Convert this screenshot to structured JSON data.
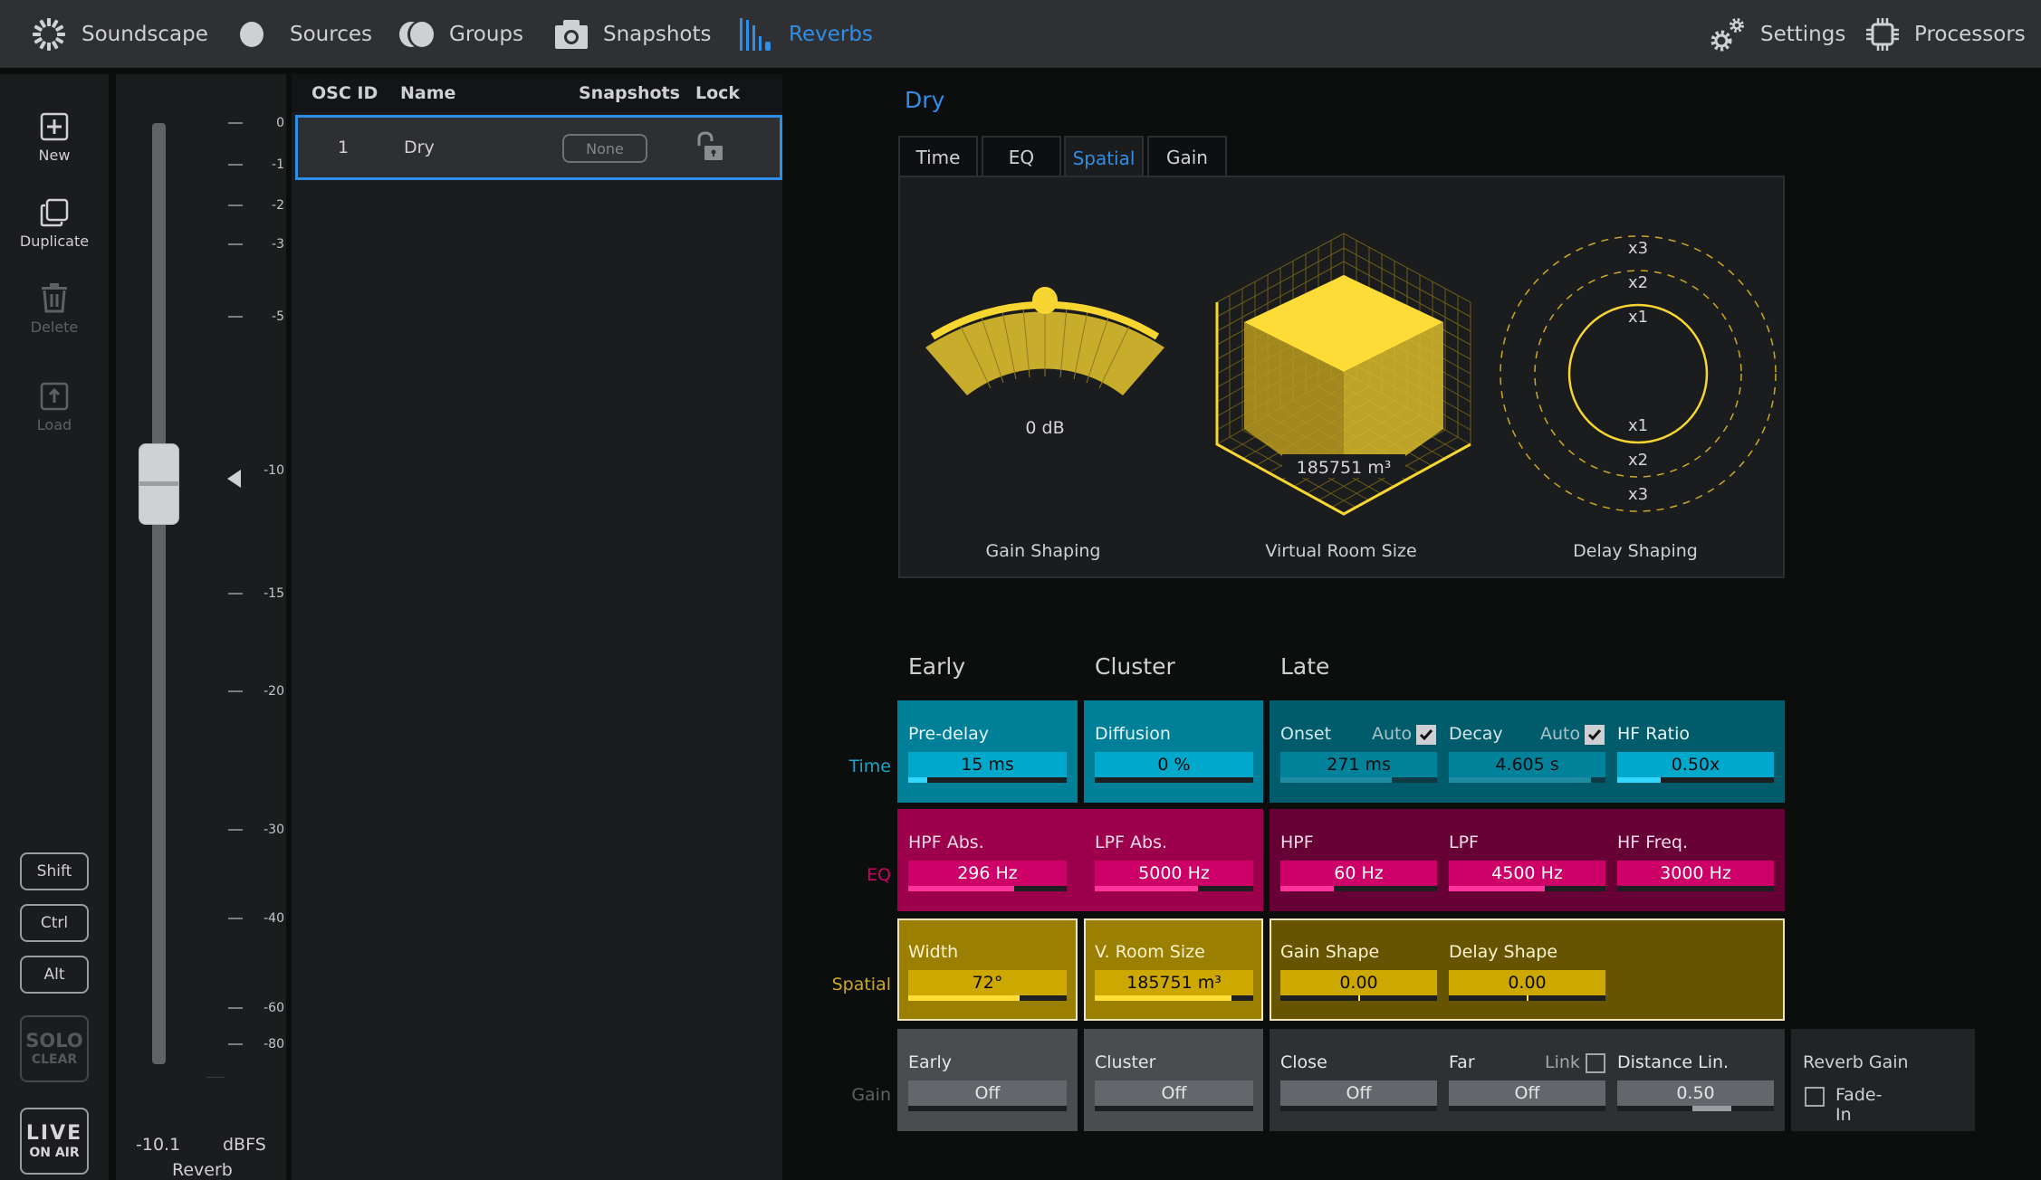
{
  "nav": {
    "items": [
      {
        "label": "Soundscape",
        "icon": "soundscape-icon"
      },
      {
        "label": "Sources",
        "icon": "sources-icon"
      },
      {
        "label": "Groups",
        "icon": "groups-icon"
      },
      {
        "label": "Snapshots",
        "icon": "camera-icon"
      },
      {
        "label": "Reverbs",
        "icon": "reverbs-icon",
        "active": true
      }
    ],
    "right": [
      {
        "label": "Settings",
        "icon": "gears-icon"
      },
      {
        "label": "Processors",
        "icon": "chip-icon"
      }
    ]
  },
  "sidebar": {
    "new": "New",
    "duplicate": "Duplicate",
    "delete": "Delete",
    "load": "Load",
    "shift": "Shift",
    "ctrl": "Ctrl",
    "alt": "Alt",
    "solo_top": "SOLO",
    "solo_bottom": "CLEAR",
    "live_top": "LIVE",
    "live_bottom": "ON AIR"
  },
  "fader": {
    "ticks": [
      "0",
      "-1",
      "-2",
      "-3",
      "-5",
      "-10",
      "-15",
      "-20",
      "-30",
      "-40",
      "-60",
      "-80"
    ],
    "value": "-10.1",
    "unit": "dBFS",
    "name": "Reverb",
    "marker_tick": "-10"
  },
  "list": {
    "headers": {
      "osc_id": "OSC ID",
      "name": "Name",
      "snapshots": "Snapshots",
      "lock": "Lock"
    },
    "rows": [
      {
        "osc_id": "1",
        "name": "Dry",
        "snapshots": "None",
        "locked": false
      }
    ]
  },
  "detail": {
    "title": "Dry",
    "tabs": [
      "Time",
      "EQ",
      "Spatial",
      "Gain"
    ],
    "active_tab": "Spatial",
    "vis": {
      "gain_shaping": {
        "label": "Gain Shaping",
        "value": "0 dB"
      },
      "room_size": {
        "label": "Virtual Room Size",
        "value": "185751 m³"
      },
      "delay_shaping": {
        "label": "Delay Shaping",
        "rings_top": [
          "x3",
          "x2",
          "x1"
        ],
        "rings_bottom": [
          "x1",
          "x2",
          "x3"
        ]
      }
    },
    "columns": [
      "Early",
      "Cluster",
      "Late"
    ],
    "rows": {
      "time": "Time",
      "eq": "EQ",
      "spatial": "Spatial",
      "gain": "Gain"
    },
    "time": {
      "predelay": {
        "label": "Pre-delay",
        "value": "15 ms",
        "fill": 0.12
      },
      "diffusion": {
        "label": "Diffusion",
        "value": "0 %",
        "fill": 0.0
      },
      "onset": {
        "label": "Onset",
        "value": "271 ms",
        "fill": 0.71,
        "auto_label": "Auto",
        "auto": true
      },
      "decay": {
        "label": "Decay",
        "value": "4.605 s",
        "fill": 0.91,
        "auto_label": "Auto",
        "auto": true
      },
      "hf_ratio": {
        "label": "HF Ratio",
        "value": "0.50x",
        "fill": 0.28
      }
    },
    "eq": {
      "hpf_abs": {
        "label": "HPF Abs.",
        "value": "296 Hz",
        "fill": 0.67
      },
      "lpf_abs": {
        "label": "LPF Abs.",
        "value": "5000 Hz",
        "fill": 0.65
      },
      "hpf": {
        "label": "HPF",
        "value": "60 Hz",
        "fill": 0.34
      },
      "lpf": {
        "label": "LPF",
        "value": "4500 Hz",
        "fill": 0.61
      },
      "hf_freq": {
        "label": "HF Freq.",
        "value": "3000 Hz",
        "fill": 0.0
      }
    },
    "spatial": {
      "width": {
        "label": "Width",
        "value": "72°",
        "fill": 0.7
      },
      "room_size": {
        "label": "V. Room Size",
        "value": "185751 m³",
        "fill": 0.86
      },
      "gain_shape": {
        "label": "Gain Shape",
        "value": "0.00",
        "center": 0.5
      },
      "delay_shape": {
        "label": "Delay Shape",
        "value": "0.00",
        "center": 0.5
      }
    },
    "gain": {
      "early": {
        "label": "Early",
        "value": "Off"
      },
      "cluster": {
        "label": "Cluster",
        "value": "Off"
      },
      "close": {
        "label": "Close",
        "value": "Off"
      },
      "far": {
        "label": "Far",
        "value": "Off",
        "link_label": "Link",
        "link": false
      },
      "distance_lin": {
        "label": "Distance Lin.",
        "value": "0.50",
        "fill_from": 0.48,
        "fill_to": 0.73
      },
      "reverb_gain": {
        "label": "Reverb Gain",
        "fade_in_label": "Fade-In",
        "fade_in": false
      }
    }
  },
  "colors": {
    "accent": "#2f8ee6",
    "time": "#007f99",
    "time_late": "#005b6b",
    "eq": "#9c004d",
    "eq_late": "#660035",
    "spatial": "#9b7f00",
    "spatial_late": "#675400",
    "gain": "#4a4c50",
    "gain_late": "#2e3134"
  }
}
